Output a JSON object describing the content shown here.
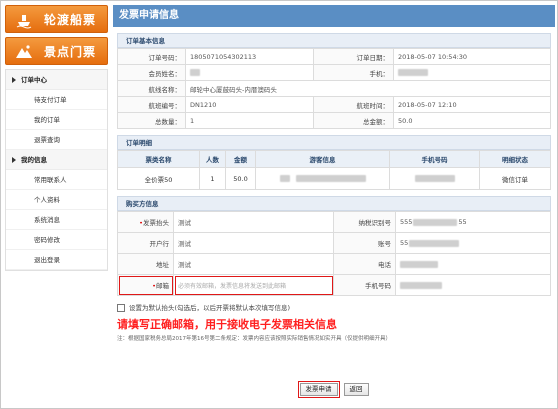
{
  "sidebar": {
    "top_buttons": [
      {
        "label": "轮渡船票",
        "icon": "ship-icon"
      },
      {
        "label": "景点门票",
        "icon": "mountain-icon"
      }
    ],
    "order_section": "订单中心",
    "order_items": [
      "待支付订单",
      "我的订单",
      "退票查询"
    ],
    "info_section": "我的信息",
    "info_items": [
      "常用联系人",
      "个人资料",
      "系统消息",
      "密码修改",
      "退出登录"
    ]
  },
  "page_title": "发票申请信息",
  "order_basic": {
    "title": "订单基本信息",
    "order_no_label": "订单号码：",
    "order_no": "1805071054302113",
    "order_date_label": "订单日期：",
    "order_date": "2018-05-07 10:54:30",
    "member_label": "会员姓名：",
    "mobile_label": "手机：",
    "route_label": "航线名称：",
    "route": "邮轮中心厦鼓码头-内厝澳码头",
    "voyage_label": "航班编号：",
    "voyage": "DN1210",
    "voyage_time_label": "航班时间：",
    "voyage_time": "2018-05-07 12:10",
    "count_label": "总数量：",
    "count": "1",
    "total_label": "总金额：",
    "total": "50.0"
  },
  "order_detail": {
    "title": "订单明细",
    "headers": [
      "票类名称",
      "人数",
      "金额",
      "游客信息",
      "手机号码",
      "明细状态"
    ],
    "rows": [
      {
        "type": "全价票50",
        "people": "1",
        "amount": "50.0",
        "status": "微信订单"
      }
    ]
  },
  "buyer": {
    "title": "购买方信息",
    "invoice_head_label": "发票抬头",
    "invoice_head": "测试",
    "tax_no_label": "纳税识别号",
    "tax_no_prefix": "555",
    "tax_no_suffix": "55",
    "bank_label": "开户行",
    "bank": "测试",
    "account_label": "账号",
    "account_prefix": "55",
    "address_label": "地址",
    "address": "测试",
    "phone_label": "电话",
    "email_label": "邮箱",
    "email_placeholder": "必须有效邮箱，发票信息将发送到此邮箱",
    "mobile_label": "手机号码",
    "required_mark": "•"
  },
  "default_checkbox_label": "设置为默认抬头(勾选后，以后开票将默认本次填写信息)",
  "annotation": "请填写正确邮箱，用于接收电子发票相关信息",
  "note": "注：根据国家税务总局2017年第16号第二条规定：发票内容应该按照实际销售情况如实开具（仅提供明细开具）",
  "buttons": {
    "apply": "发票申请",
    "back": "返回"
  }
}
